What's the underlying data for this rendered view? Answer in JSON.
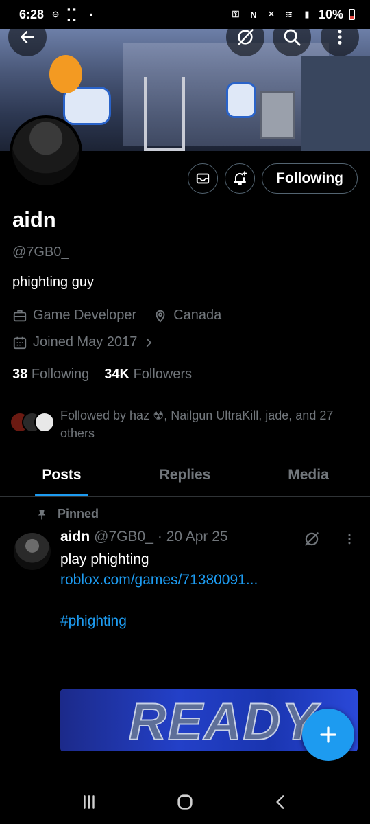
{
  "status_bar": {
    "time": "6:28",
    "battery": "10%"
  },
  "profile": {
    "name": "aidn",
    "handle": "@7GB0_",
    "bio": "phighting guy",
    "profession": "Game Developer",
    "location": "Canada",
    "joined": "Joined May 2017",
    "following_count": "38",
    "following_label": "Following",
    "followers_count": "34K",
    "followers_label": "Followers",
    "follow_button": "Following",
    "followed_by": "Followed by haz ☢, Nailgun UltraKill, jade, and 27 others"
  },
  "tabs": [
    {
      "label": "Posts",
      "active": true
    },
    {
      "label": "Replies",
      "active": false
    },
    {
      "label": "Media",
      "active": false
    }
  ],
  "pinned_tweet": {
    "pinned_label": "Pinned",
    "author": "aidn",
    "handle": "@7GB0_",
    "date": "· 20 Apr 25",
    "text": "play phighting",
    "link": "roblox.com/games/71380091...",
    "hashtag": "#phighting",
    "media_text": "READY"
  },
  "colors": {
    "accent": "#1d9bf0",
    "muted": "#71767b",
    "background": "#000000"
  }
}
